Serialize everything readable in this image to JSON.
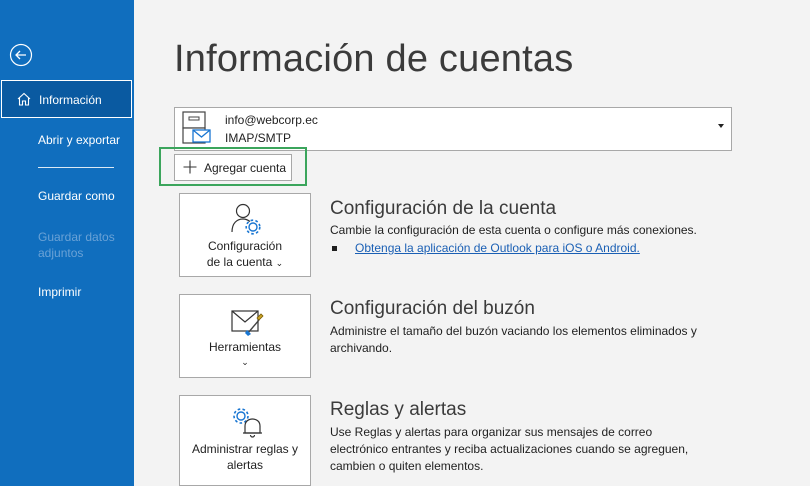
{
  "sidebar": {
    "items": [
      {
        "label": "Información",
        "active": true
      },
      {
        "label": "Abrir y exportar"
      },
      {
        "label": "Guardar como"
      },
      {
        "label": "Guardar datos adjuntos",
        "disabled": true
      },
      {
        "label": "Imprimir"
      }
    ],
    "disabled_line1": "Guardar datos",
    "disabled_line2": "adjuntos",
    "icons": {
      "back": "back-arrow-icon",
      "home": "home-icon"
    }
  },
  "main": {
    "title": "Información de cuentas",
    "account": {
      "email": "info@webcorp.ec",
      "type": "IMAP/SMTP"
    },
    "add_account_label": "Agregar cuenta",
    "sections": [
      {
        "tile_line1": "Configuración",
        "tile_line2": "de la cuenta",
        "title": "Configuración de la cuenta",
        "description": "Cambie la configuración de esta cuenta o configure más conexiones.",
        "link": "Obtenga la aplicación de Outlook para iOS o Android."
      },
      {
        "tile_line1": "Herramientas",
        "title": "Configuración del buzón",
        "description": "Administre el tamaño del buzón vaciando los elementos eliminados y archivando."
      },
      {
        "tile_line1": "Administrar reglas y",
        "tile_line2": "alertas",
        "title": "Reglas y alertas",
        "description": "Use Reglas y alertas para organizar sus mensajes de correo electrónico entrantes y reciba actualizaciones cuando se agreguen, cambien o quiten elementos."
      }
    ]
  },
  "colors": {
    "sidebar": "#106ebe",
    "highlight": "#3ba55c",
    "link": "#1a5fb4"
  }
}
